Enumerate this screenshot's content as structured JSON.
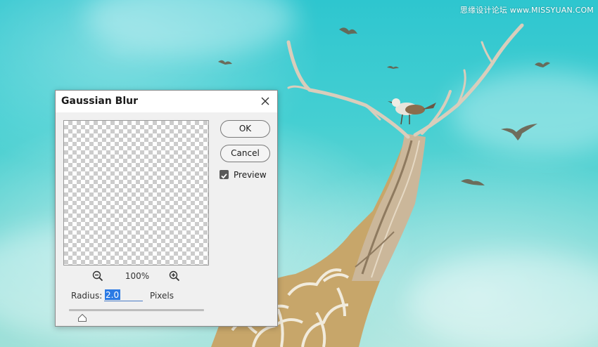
{
  "watermark": {
    "text": "思缘设计论坛 www.MISSYUAN.COM"
  },
  "background": {
    "sky_color": "#3ccbd1",
    "scene": "surreal artwork: giraffe neck turning into tree branch with a bird, birds in sky"
  },
  "dialog": {
    "title": "Gaussian Blur",
    "close_icon": "close-icon",
    "buttons": {
      "ok_label": "OK",
      "cancel_label": "Cancel"
    },
    "preview": {
      "label": "Preview",
      "checked": true
    },
    "zoom": {
      "level": "100%",
      "zoom_out_icon": "zoom-out-icon",
      "zoom_in_icon": "zoom-in-icon"
    },
    "radius": {
      "label": "Radius:",
      "value": "2.0",
      "units": "Pixels",
      "slider_fraction": 0.05
    },
    "accent_color": "#2b7ae4"
  }
}
